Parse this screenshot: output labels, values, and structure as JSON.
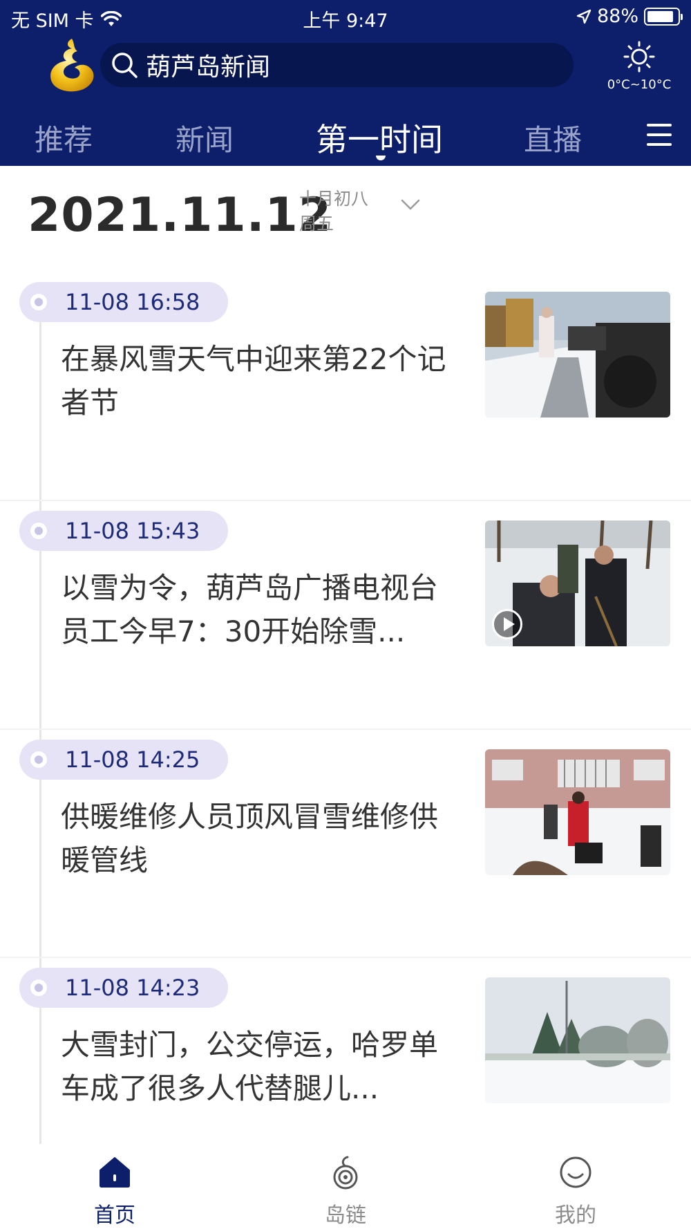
{
  "colors": {
    "header_bg": "#0d1f6b",
    "search_bg": "#08164f",
    "pill_bg": "#e6e3f6",
    "accent": "#1c2a78"
  },
  "status_bar": {
    "carrier": "无 SIM 卡",
    "time": "上午 9:47",
    "battery": "88%"
  },
  "header": {
    "search_text": "葫芦岛新闻",
    "weather_temp": "0°C~10°C"
  },
  "tabs": [
    {
      "label": "推荐",
      "active": false
    },
    {
      "label": "新闻",
      "active": false
    },
    {
      "label": "第一时间",
      "active": true
    },
    {
      "label": "直播",
      "active": false
    }
  ],
  "date_header": {
    "date": "2021.11.12",
    "lunar": "十月初八",
    "weekday": "周五"
  },
  "news": [
    {
      "time": "11-08 16:58",
      "title": "在暴风雪天气中迎来第22个记者节",
      "has_video": false
    },
    {
      "time": "11-08 15:43",
      "title": "以雪为令，葫芦岛广播电视台员工今早7：30开始除雪...",
      "has_video": true
    },
    {
      "time": "11-08 14:25",
      "title": "供暖维修人员顶风冒雪维修供暖管线",
      "has_video": false
    },
    {
      "time": "11-08 14:23",
      "title": "大雪封门，公交停运，哈罗单车成了很多人代替腿儿...",
      "has_video": false
    }
  ],
  "bottom_nav": [
    {
      "label": "首页",
      "active": true
    },
    {
      "label": "岛链",
      "active": false
    },
    {
      "label": "我的",
      "active": false
    }
  ]
}
